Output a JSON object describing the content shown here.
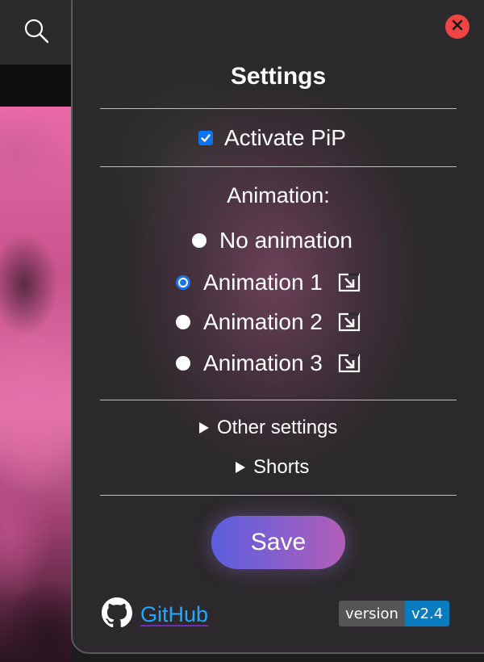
{
  "background": {
    "search_icon": "search-icon"
  },
  "panel": {
    "close_icon": "close-icon",
    "title": "Settings",
    "pip": {
      "label": "Activate PiP",
      "checked": true
    },
    "animation": {
      "heading": "Animation:",
      "options": [
        {
          "label": "No animation",
          "selected": false,
          "has_edit": false
        },
        {
          "label": "Animation 1",
          "selected": true,
          "has_edit": true
        },
        {
          "label": "Animation 2",
          "selected": false,
          "has_edit": true
        },
        {
          "label": "Animation 3",
          "selected": false,
          "has_edit": true
        }
      ]
    },
    "sections": {
      "other_settings": "Other settings",
      "shorts": "Shorts"
    },
    "save_label": "Save",
    "footer": {
      "github_label": "GitHub",
      "version_label": "version",
      "version_value": "v2.4"
    }
  },
  "colors": {
    "accent": "#1a73e8",
    "close": "#ef4444",
    "link": "#22a8ff",
    "badge_value": "#0a7bbf"
  }
}
